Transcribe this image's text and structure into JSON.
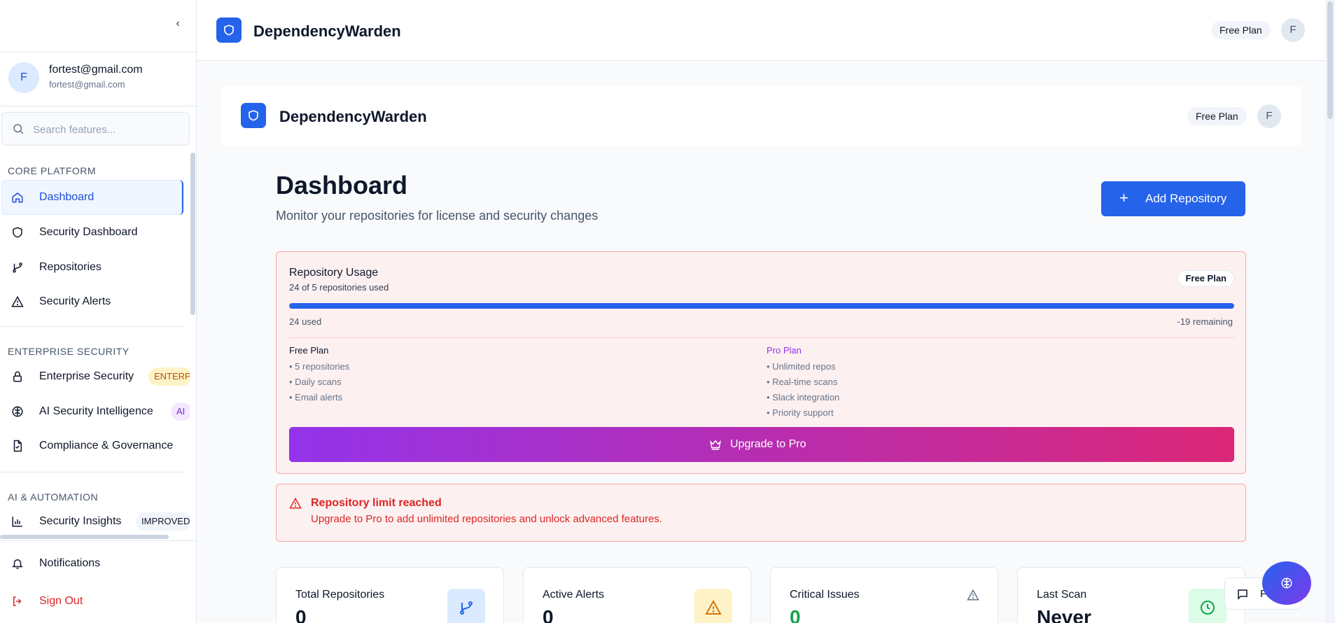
{
  "app": {
    "name": "DependencyWarden",
    "plan": "Free Plan",
    "avatar_initial": "F"
  },
  "sidebar": {
    "user": {
      "initial": "F",
      "name": "fortest@gmail.com",
      "email": "fortest@gmail.com"
    },
    "search": {
      "placeholder": "Search features..."
    },
    "sections": {
      "core": "CORE PLATFORM",
      "enterprise": "ENTERPRISE SECURITY",
      "ai": "AI & AUTOMATION"
    },
    "items": {
      "dashboard": "Dashboard",
      "security_dashboard": "Security Dashboard",
      "repositories": "Repositories",
      "security_alerts": "Security Alerts",
      "enterprise_security": "Enterprise Security",
      "enterprise_badge": "ENTERPRISE",
      "ai_intelligence": "AI Security Intelligence",
      "ai_badge": "AI",
      "compliance": "Compliance & Governance",
      "security_insights": "Security Insights",
      "insights_badge": "IMPROVED"
    },
    "bottom": {
      "notifications": "Notifications",
      "sign_out": "Sign Out"
    }
  },
  "main": {
    "title": "Dashboard",
    "subtitle": "Monitor your repositories for license and security changes",
    "add_repo": "Add Repository",
    "usage": {
      "title": "Repository Usage",
      "summary": "24 of 5 repositories used",
      "plan_badge": "Free Plan",
      "progress_fraction": 1.0,
      "used": "24 used",
      "remaining": "-19 remaining",
      "free_plan": {
        "title": "Free Plan",
        "features": [
          "• 5 repositories",
          "• Daily scans",
          "• Email alerts"
        ]
      },
      "pro_plan": {
        "title": "Pro Plan",
        "features": [
          "• Unlimited repos",
          "• Real-time scans",
          "• Slack integration",
          "• Priority support"
        ]
      },
      "upgrade": "Upgrade to Pro"
    },
    "limit_alert": {
      "title": "Repository limit reached",
      "description": "Upgrade to Pro to add unlimited repositories and unlock advanced features."
    },
    "stats": [
      {
        "label": "Total Repositories",
        "value": "0",
        "icon": "git-branch-icon"
      },
      {
        "label": "Active Alerts",
        "value": "0",
        "icon": "warning-icon"
      },
      {
        "label": "Critical Issues",
        "value": "0",
        "icon": "warning-outline-icon"
      },
      {
        "label": "Last Scan",
        "value": "Never",
        "icon": "clock-icon"
      }
    ],
    "feedback": "Feedback"
  },
  "colors": {
    "primary": "#2563eb",
    "danger": "#dc2626",
    "pro": "#9333ea",
    "gradient_end": "#db2777"
  }
}
